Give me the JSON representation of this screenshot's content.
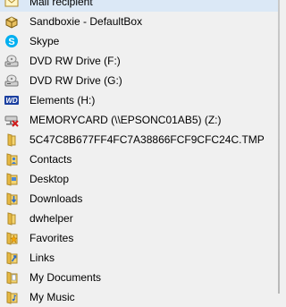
{
  "menu": {
    "items": [
      {
        "label": "Mail recipient",
        "icon": "mail-recipient-icon"
      },
      {
        "label": "Sandboxie - DefaultBox",
        "icon": "sandboxie-icon"
      },
      {
        "label": "Skype",
        "icon": "skype-icon"
      },
      {
        "label": "DVD RW Drive (F:)",
        "icon": "dvd-drive-icon"
      },
      {
        "label": "DVD RW Drive (G:)",
        "icon": "dvd-drive-icon"
      },
      {
        "label": "Elements (H:)",
        "icon": "wd-drive-icon"
      },
      {
        "label": "MEMORYCARD (\\\\EPSONC01AB5) (Z:)",
        "icon": "disconnected-network-drive-icon"
      },
      {
        "label": "5C47C8B677FF4FC7A38866FCF9CFC24C.TMP",
        "icon": "folder-icon"
      },
      {
        "label": "Contacts",
        "icon": "contacts-folder-icon"
      },
      {
        "label": "Desktop",
        "icon": "desktop-folder-icon"
      },
      {
        "label": "Downloads",
        "icon": "downloads-folder-icon"
      },
      {
        "label": "dwhelper",
        "icon": "folder-icon"
      },
      {
        "label": "Favorites",
        "icon": "favorites-folder-icon"
      },
      {
        "label": "Links",
        "icon": "links-folder-icon"
      },
      {
        "label": "My Documents",
        "icon": "documents-folder-icon"
      },
      {
        "label": "My Music",
        "icon": "music-folder-icon"
      }
    ]
  }
}
